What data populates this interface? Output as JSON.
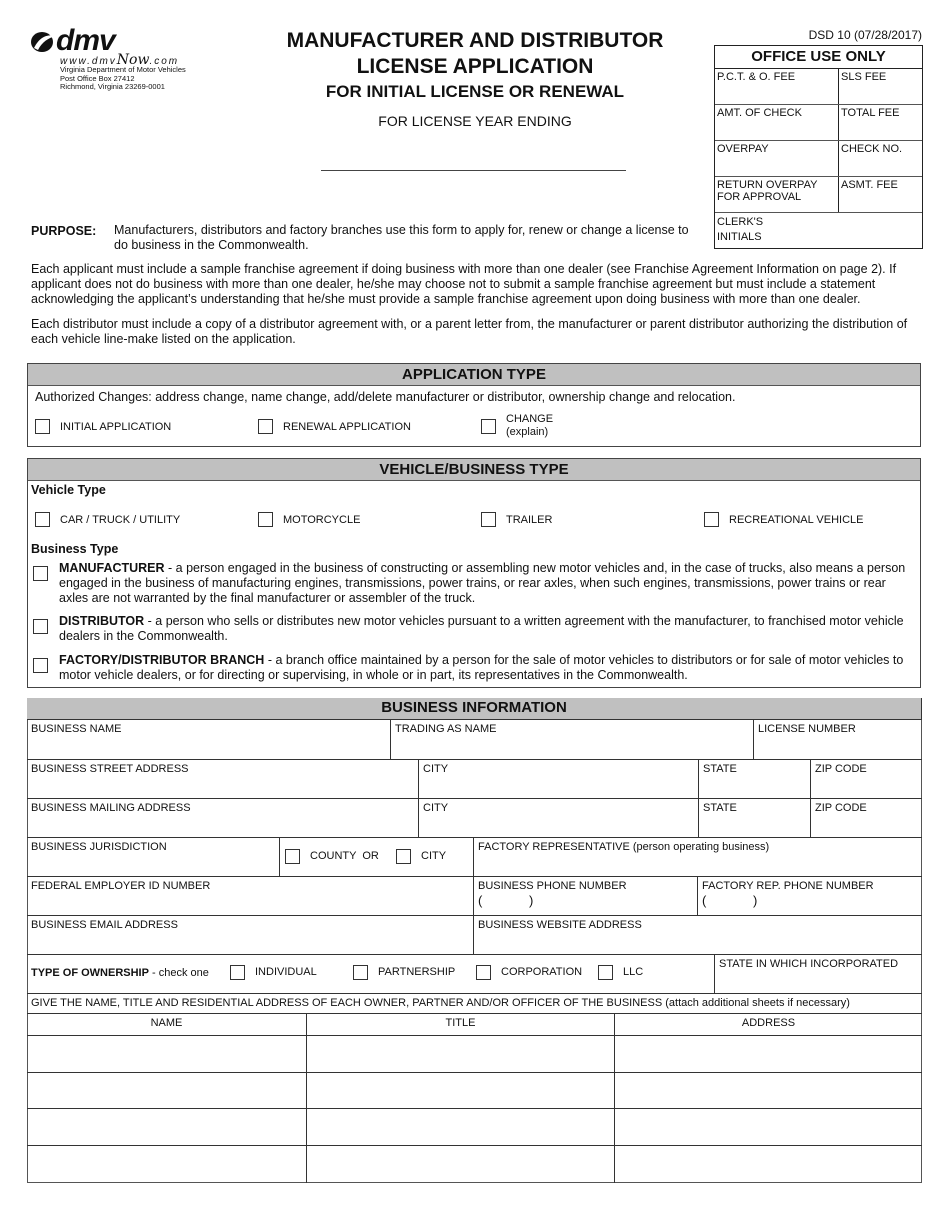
{
  "logo": {
    "brand": "dmv",
    "url_prefix": "www.dmv",
    "url_now": "Now",
    "url_suffix": ".com",
    "address_lines": [
      "Virginia Department of Motor Vehicles",
      "Post Office Box 27412",
      "Richmond, Virginia 23269-0001"
    ]
  },
  "header": {
    "title_line1": "MANUFACTURER AND DISTRIBUTOR",
    "title_line2": "LICENSE APPLICATION",
    "subtitle": "FOR INITIAL LICENSE OR RENEWAL",
    "year_label": "FOR LICENSE YEAR ENDING",
    "year_value": "",
    "form_number": "DSD 10 (07/28/2017)"
  },
  "office_use": {
    "title": "OFFICE USE ONLY",
    "rows": [
      [
        "P.C.T. & O. FEE",
        "SLS FEE"
      ],
      [
        "AMT. OF CHECK",
        "TOTAL FEE"
      ],
      [
        "OVERPAY",
        "CHECK NO."
      ],
      [
        "RETURN OVERPAY FOR APPROVAL",
        "ASMT. FEE"
      ]
    ],
    "clerk_line1": "CLERK'S",
    "clerk_line2": "INITIALS"
  },
  "intro": {
    "purpose_label": "PURPOSE:",
    "purpose_text": "Manufacturers, distributors and factory branches use this form to apply for, renew or change a license to do business in the Commonwealth.",
    "paragraph1": "Each applicant must include a sample franchise agreement if doing business with more than one dealer (see Franchise Agreement Information on page 2).  If applicant does not do business with more than one dealer, he/she may choose not to submit a sample franchise agreement but must include a statement acknowledging the applicant’s understanding that he/she must provide a sample franchise agreement upon doing business with more than one dealer.",
    "paragraph2": "Each distributor must include a copy of a distributor agreement with, or a parent letter from, the manufacturer or parent distributor authorizing the distribution of each vehicle line-make listed on the application."
  },
  "application_type": {
    "title": "APPLICATION TYPE",
    "note": "Authorized Changes: address change, name change, add/delete manufacturer or distributor, ownership change and relocation.",
    "options": [
      {
        "label": "INITIAL APPLICATION",
        "checked": false
      },
      {
        "label": "RENEWAL APPLICATION",
        "checked": false
      },
      {
        "label": "CHANGE",
        "sub": "(explain)",
        "checked": false
      }
    ]
  },
  "vehicle_business": {
    "title": "VEHICLE/BUSINESS TYPE",
    "vehicle_type_label": "Vehicle Type",
    "vehicle_types": [
      {
        "label": "CAR / TRUCK / UTILITY",
        "checked": false
      },
      {
        "label": "MOTORCYCLE",
        "checked": false
      },
      {
        "label": "TRAILER",
        "checked": false
      },
      {
        "label": "RECREATIONAL VEHICLE",
        "checked": false
      }
    ],
    "business_type_label": "Business Type",
    "business_types": [
      {
        "term": "MANUFACTURER",
        "definition": " - a person engaged in the business of constructing or assembling new motor vehicles and, in the case of trucks, also means a person engaged in the business of manufacturing engines, transmissions, power trains, or rear axles, when such engines, transmissions, power trains or rear axles are not warranted by the final manufacturer or assembler of the truck.",
        "checked": false
      },
      {
        "term": "DISTRIBUTOR",
        "definition": " - a person who sells or distributes new motor vehicles pursuant to a written agreement with the manufacturer, to franchised motor vehicle dealers in the Commonwealth.",
        "checked": false
      },
      {
        "term": "FACTORY/DISTRIBUTOR BRANCH",
        "definition": " - a branch office maintained by a person for the sale of motor vehicles to distributors or for sale of motor vehicles to motor vehicle dealers, or for directing or supervising, in whole or in part, its representatives in the Commonwealth.",
        "checked": false
      }
    ]
  },
  "business_info": {
    "title": "BUSINESS INFORMATION",
    "business_name": "BUSINESS NAME",
    "trading_as": "TRADING AS NAME",
    "license_number": "LICENSE NUMBER",
    "street_address": "BUSINESS  STREET ADDRESS",
    "mailing_address": "BUSINESS MAILING ADDRESS",
    "city": "CITY",
    "state": "STATE",
    "zip": "ZIP CODE",
    "jurisdiction": "BUSINESS JURISDICTION",
    "county_or": "COUNTY  OR",
    "city_option": "CITY",
    "factory_rep": "FACTORY REPRESENTATIVE (person operating business)",
    "fein": "FEDERAL EMPLOYER ID NUMBER",
    "business_phone": "BUSINESS PHONE NUMBER",
    "factory_rep_phone": "FACTORY REP. PHONE NUMBER",
    "paren_open": "(",
    "paren_close": ")",
    "email": "BUSINESS EMAIL ADDRESS",
    "website": "BUSINESS WEBSITE ADDRESS",
    "ownership_label": "TYPE OF OWNERSHIP",
    "ownership_hint": " - check one",
    "ownership_options": [
      {
        "label": "INDIVIDUAL",
        "checked": false
      },
      {
        "label": "PARTNERSHIP",
        "checked": false
      },
      {
        "label": "CORPORATION",
        "checked": false
      },
      {
        "label": "LLC",
        "checked": false
      }
    ],
    "state_incorporated": "STATE IN WHICH INCORPORATED",
    "owners_instruction": "GIVE THE NAME, TITLE AND RESIDENTIAL ADDRESS OF EACH OWNER, PARTNER AND/OR OFFICER OF THE BUSINESS (attach additional sheets if necessary)",
    "owners_columns": [
      "NAME",
      "TITLE",
      "ADDRESS"
    ],
    "owners_rows": [
      [
        "",
        "",
        ""
      ],
      [
        "",
        "",
        ""
      ],
      [
        "",
        "",
        ""
      ],
      [
        "",
        "",
        ""
      ]
    ]
  }
}
